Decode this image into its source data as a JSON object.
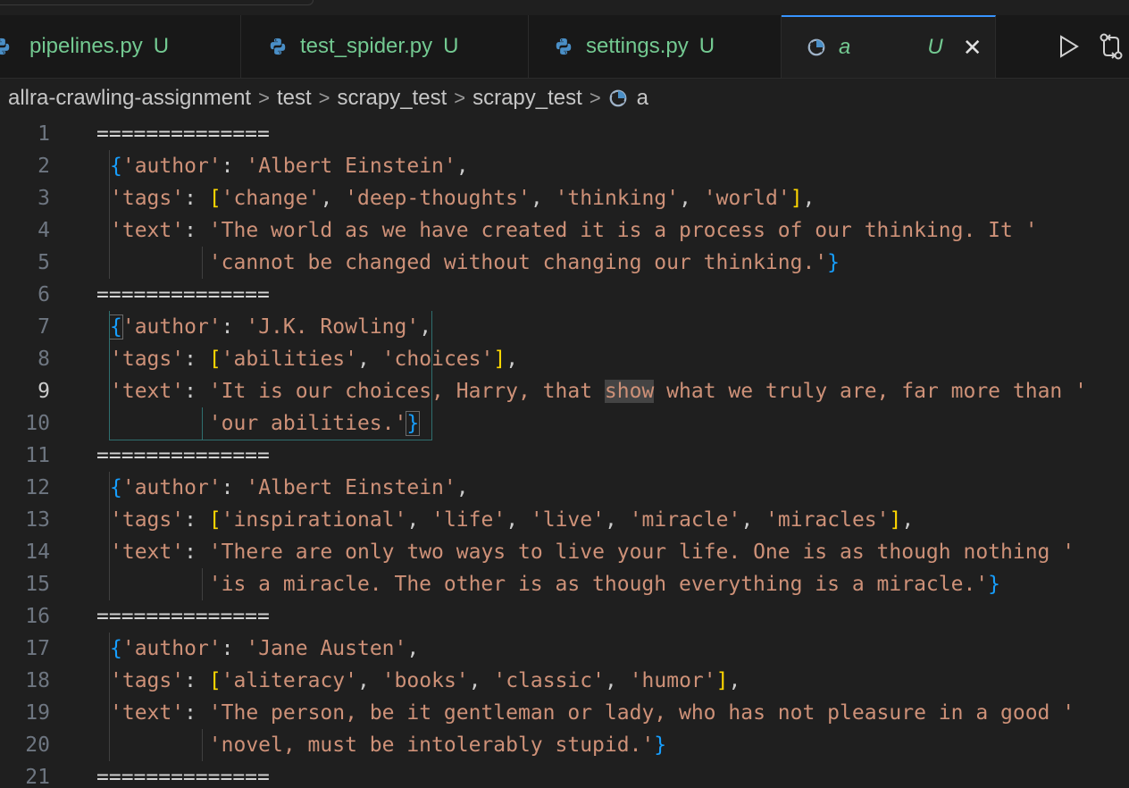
{
  "tabs": [
    {
      "label": "pipelines.py",
      "badge": "U",
      "icon": "python-icon"
    },
    {
      "label": "test_spider.py",
      "badge": "U",
      "icon": "python-icon"
    },
    {
      "label": "settings.py",
      "badge": "U",
      "icon": "python-icon"
    },
    {
      "label": "a",
      "badge": "U",
      "icon": "file-icon",
      "active": true,
      "close": "✕"
    }
  ],
  "breadcrumb": [
    "allra-crawling-assignment",
    "test",
    "scrapy_test",
    "scrapy_test",
    "a"
  ],
  "breadcrumb_separator": ">",
  "lines": [
    "==============",
    "{'author': 'Albert Einstein',",
    "'tags': ['change', 'deep-thoughts', 'thinking', 'world'],",
    "'text': 'The world as we have created it is a process of our thinking. It '",
    "        'cannot be changed without changing our thinking.'}",
    "==============",
    "{'author': 'J.K. Rowling',",
    "'tags': ['abilities', 'choices'],",
    "'text': 'It is our choices, Harry, that show what we truly are, far more than '",
    "        'our abilities.'}",
    "==============",
    "{'author': 'Albert Einstein',",
    "'tags': ['inspirational', 'life', 'live', 'miracle', 'miracles'],",
    "'text': 'There are only two ways to live your life. One is as though nothing '",
    "        'is a miracle. The other is as though everything is a miracle.'}",
    "==============",
    "{'author': 'Jane Austen',",
    "'tags': ['aliteracy', 'books', 'classic', 'humor'],",
    "'text': 'The person, be it gentleman or lady, who has not pleasure in a good '",
    "        'novel, must be intolerably stupid.'}",
    "=============="
  ],
  "current_line": 9,
  "highlighted_word": "show",
  "colors": {
    "string": "#ce9178",
    "bracket_yellow": "#ffd700",
    "bracket_blue": "#179fff",
    "git_untracked": "#73c991",
    "tab_active_border": "#3794ff"
  },
  "actions": [
    {
      "icon": "run-icon"
    },
    {
      "icon": "compare-changes-icon"
    }
  ]
}
